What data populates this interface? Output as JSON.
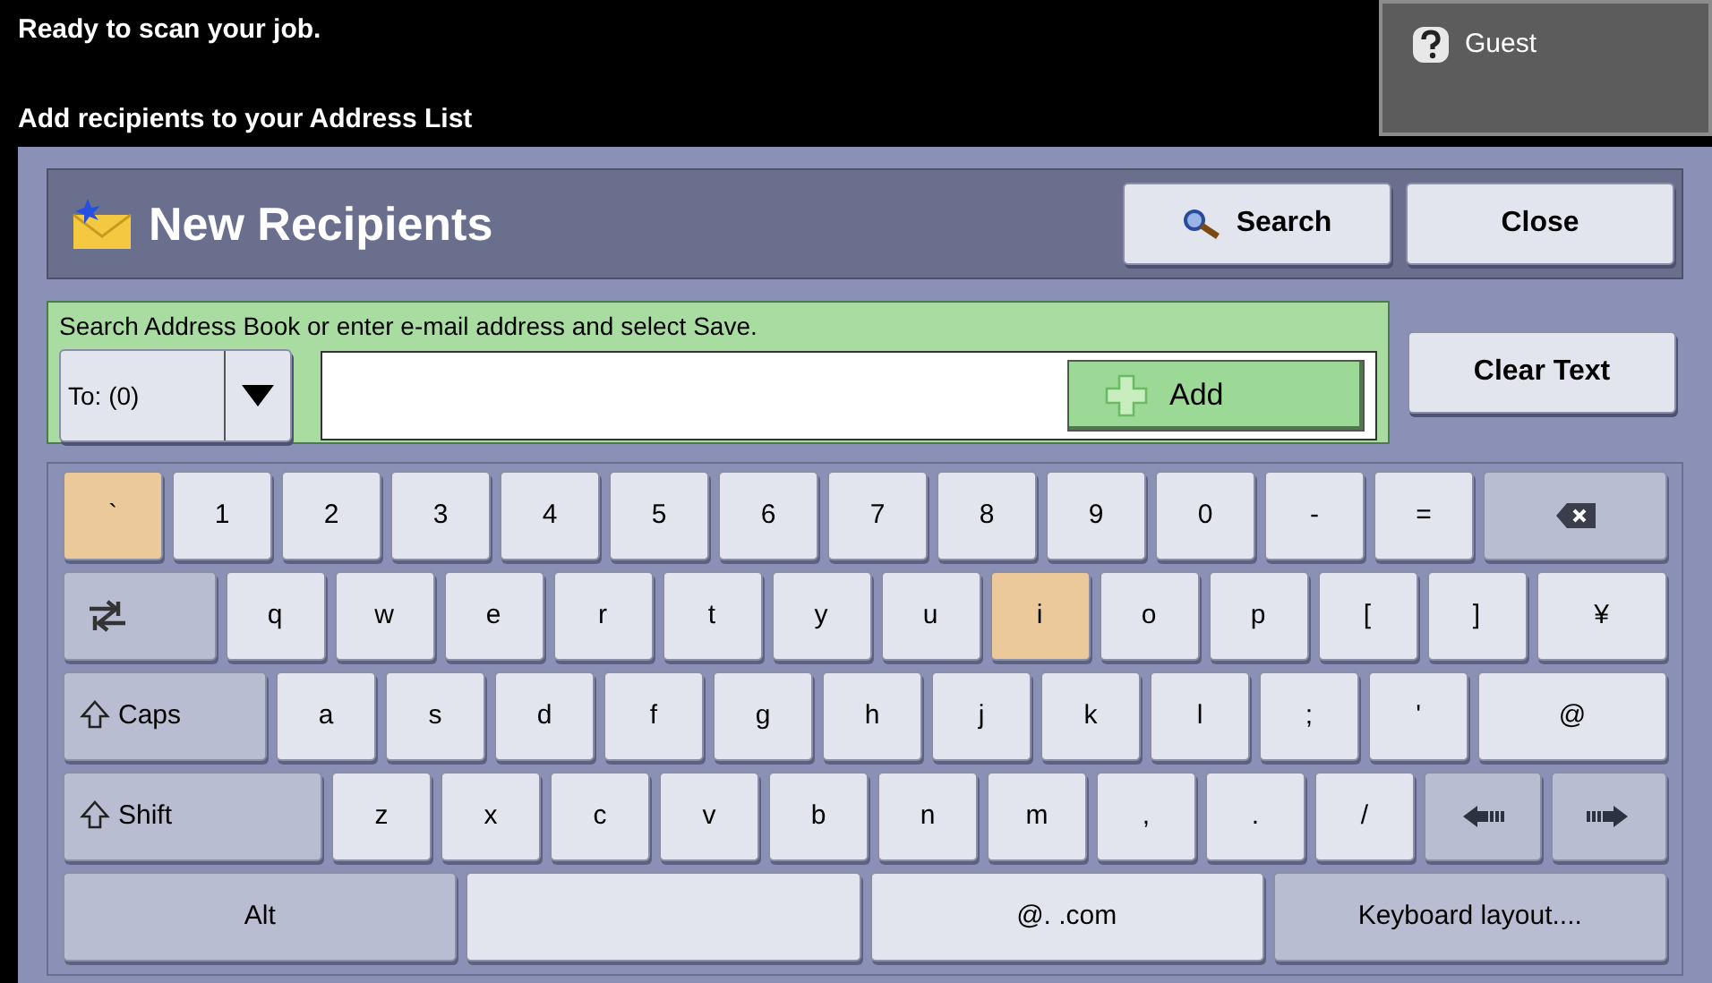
{
  "status": {
    "message": "Ready to scan your job.",
    "instruction": "Add recipients to your Address List"
  },
  "user_button": {
    "label": "Guest"
  },
  "header": {
    "title": "New Recipients",
    "buttons": [
      {
        "kind": "search",
        "label": "Search"
      },
      {
        "kind": "plain",
        "label": "Close"
      }
    ]
  },
  "address_entry": {
    "hint": "Search Address Book or enter e-mail address and select Save.",
    "recipient_type": "To: (0)",
    "add_button": "Add"
  },
  "clear_text_button": "Clear Text",
  "keyboard": {
    "rows": [
      {
        "keys": [
          {
            "kind": "char",
            "label": "`",
            "selected": true
          },
          {
            "kind": "char",
            "label": "1",
            "selected": false
          },
          {
            "kind": "char",
            "label": "2",
            "selected": false
          },
          {
            "kind": "char",
            "label": "3",
            "selected": false
          },
          {
            "kind": "char",
            "label": "4",
            "selected": false
          },
          {
            "kind": "char",
            "label": "5",
            "selected": false
          },
          {
            "kind": "char",
            "label": "6",
            "selected": false
          },
          {
            "kind": "char",
            "label": "7",
            "selected": false
          },
          {
            "kind": "char",
            "label": "8",
            "selected": false
          },
          {
            "kind": "char",
            "label": "9",
            "selected": false
          },
          {
            "kind": "char",
            "label": "0",
            "selected": false
          },
          {
            "kind": "char",
            "label": "-",
            "selected": false
          },
          {
            "kind": "char",
            "label": "=",
            "selected": false
          },
          {
            "kind": "backspace"
          }
        ]
      },
      {
        "keys": [
          {
            "kind": "tab"
          },
          {
            "kind": "char",
            "label": "q",
            "selected": false
          },
          {
            "kind": "char",
            "label": "w",
            "selected": false
          },
          {
            "kind": "char",
            "label": "e",
            "selected": false
          },
          {
            "kind": "char",
            "label": "r",
            "selected": false
          },
          {
            "kind": "char",
            "label": "t",
            "selected": false
          },
          {
            "kind": "char",
            "label": "y",
            "selected": false
          },
          {
            "kind": "char",
            "label": "u",
            "selected": false
          },
          {
            "kind": "char",
            "label": "i",
            "selected": true
          },
          {
            "kind": "char",
            "label": "o",
            "selected": false
          },
          {
            "kind": "char",
            "label": "p",
            "selected": false
          },
          {
            "kind": "char",
            "label": "[",
            "selected": false
          },
          {
            "kind": "char",
            "label": "]",
            "selected": false
          },
          {
            "kind": "wide",
            "label": "¥",
            "selected": false
          }
        ]
      },
      {
        "keys": [
          {
            "kind": "caps",
            "label": "Caps"
          },
          {
            "kind": "char",
            "label": "a",
            "selected": false
          },
          {
            "kind": "char",
            "label": "s",
            "selected": false
          },
          {
            "kind": "char",
            "label": "d",
            "selected": false
          },
          {
            "kind": "char",
            "label": "f",
            "selected": false
          },
          {
            "kind": "char",
            "label": "g",
            "selected": false
          },
          {
            "kind": "char",
            "label": "h",
            "selected": false
          },
          {
            "kind": "char",
            "label": "j",
            "selected": false
          },
          {
            "kind": "char",
            "label": "k",
            "selected": false
          },
          {
            "kind": "char",
            "label": "l",
            "selected": false
          },
          {
            "kind": "char",
            "label": ";",
            "selected": false
          },
          {
            "kind": "char",
            "label": "'",
            "selected": false
          },
          {
            "kind": "wide",
            "label": "@",
            "selected": false
          }
        ]
      },
      {
        "keys": [
          {
            "kind": "shift",
            "label": "Shift"
          },
          {
            "kind": "char",
            "label": "z",
            "selected": false
          },
          {
            "kind": "char",
            "label": "x",
            "selected": false
          },
          {
            "kind": "char",
            "label": "c",
            "selected": false
          },
          {
            "kind": "char",
            "label": "v",
            "selected": false
          },
          {
            "kind": "char",
            "label": "b",
            "selected": false
          },
          {
            "kind": "char",
            "label": "n",
            "selected": false
          },
          {
            "kind": "char",
            "label": "m",
            "selected": false
          },
          {
            "kind": "char",
            "label": ",",
            "selected": false
          },
          {
            "kind": "char",
            "label": ".",
            "selected": false
          },
          {
            "kind": "char",
            "label": "/",
            "selected": false
          },
          {
            "kind": "left"
          },
          {
            "kind": "right"
          }
        ]
      },
      {
        "keys": [
          {
            "kind": "function",
            "label": "Alt"
          },
          {
            "kind": "space"
          },
          {
            "kind": "wide",
            "label": "@.  .com",
            "selected": false
          },
          {
            "kind": "function",
            "label": "Keyboard layout...."
          }
        ]
      }
    ]
  }
}
